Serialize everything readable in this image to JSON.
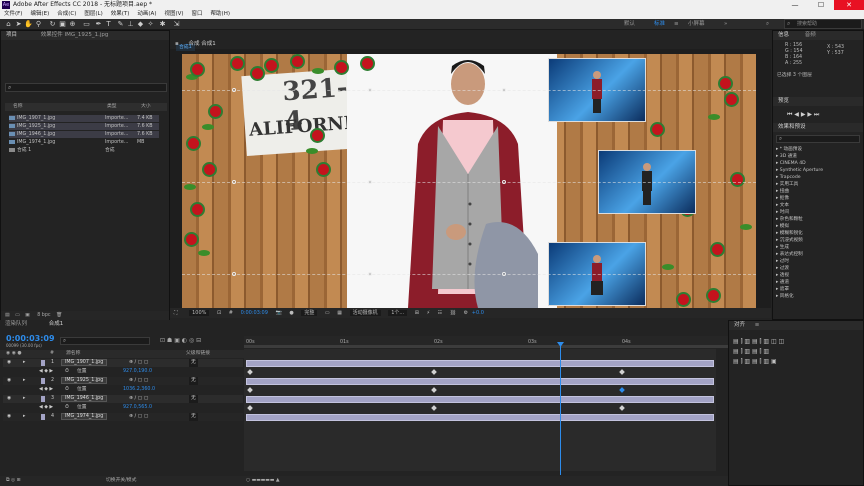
{
  "window": {
    "title": "Adobe After Effects CC 2018 - 无标题项目.aep *",
    "app_icon": "Ae",
    "min": "—",
    "max": "☐",
    "close": "✕"
  },
  "menu": [
    "文件(F)",
    "编辑(E)",
    "合成(C)",
    "图层(L)",
    "效果(T)",
    "动画(A)",
    "视图(V)",
    "窗口",
    "帮助(H)"
  ],
  "workspaces": {
    "default": "默认",
    "standard": "标准",
    "small_screen": "小屏幕",
    "more": "»",
    "menu": "≡"
  },
  "search": {
    "placeholder": "搜索帮助"
  },
  "project_panel": {
    "tabs": {
      "project": "项目",
      "effect_controls": "效果控件 IMG_1925_1.jpg"
    },
    "search_icon": "⌕",
    "columns": {
      "name": "名称",
      "type": "类型",
      "size": "大小"
    },
    "items": [
      {
        "name": "IMG_1907_1.jpg",
        "type": "Importe...",
        "size": "7.4 KB"
      },
      {
        "name": "IMG_1925_1.jpg",
        "type": "Importe...",
        "size": "7.6 KB"
      },
      {
        "name": "IMG_1946_1.jpg",
        "type": "Importe...",
        "size": "7.6 KB"
      },
      {
        "name": "IMG_1974_1.jpg",
        "type": "Importe...",
        "size": "MB"
      },
      {
        "name": "合成 1",
        "type": "合成",
        "size": ""
      }
    ],
    "bpc": "8 bpc"
  },
  "composition": {
    "tab": "合成 合成1",
    "breadcrumb": "合成1",
    "sign_line1": "321-4",
    "sign_line2": "ALIFORNIA",
    "footer": {
      "zoom": "100%",
      "time": "0:00:03:09",
      "quality": "完整",
      "camera": "活动摄像机",
      "views": "1个...",
      "exposure": "+0.0"
    }
  },
  "info_panel": {
    "tabs": {
      "info": "信息",
      "audio": "音频"
    },
    "r": "R : 156",
    "g": "G : 154",
    "b": "B : 164",
    "a": "A : 255",
    "x": "X : 543",
    "y": "Y : 537",
    "selected": "已选择 3 个图层"
  },
  "preview": {
    "tab": "预览",
    "controls": "⏮ ◀ ▶ ▶ ⏭"
  },
  "effects": {
    "tab": "效果和预设",
    "search_icon": "⌕",
    "items": [
      "* 动画预设",
      "3D 通道",
      "CINEMA 4D",
      "Synthetic Aperture",
      "Trapcode",
      "实用工具",
      "扭曲",
      "抠像",
      "文本",
      "时间",
      "杂色和颗粒",
      "模拟",
      "模糊和锐化",
      "沉浸式视频",
      "生成",
      "表达式控制",
      "过时",
      "过渡",
      "透视",
      "通道",
      "遮罩",
      "风格化"
    ]
  },
  "timeline": {
    "tabs": {
      "render": "渲染队列",
      "comp": "合成1"
    },
    "timecode": "0:00:03:09",
    "timecode_sub": "00099 (30.00 fps)",
    "search_icon": "⌕",
    "columns": {
      "label": "#",
      "name": "源名称",
      "parent": "父级和链接"
    },
    "ruler": [
      "00s",
      "01s",
      "02s",
      "03s",
      "04s"
    ],
    "layers": [
      {
        "num": "1",
        "name": "IMG_1907_1.jpg",
        "parent": "无",
        "prop": "位置",
        "value": "927.0,190.0"
      },
      {
        "num": "2",
        "name": "IMG_1925_1.jpg",
        "parent": "无",
        "prop": "位置",
        "value": "1036.2,360.0"
      },
      {
        "num": "3",
        "name": "IMG_1946_1.jpg",
        "parent": "无",
        "prop": "位置",
        "value": "927.0,565.0"
      },
      {
        "num": "4",
        "name": "IMG_1974_1.jpg",
        "parent": "无",
        "prop": "",
        "value": ""
      }
    ],
    "footer": "切换开关/模式"
  },
  "align_panel": {
    "tab": "对齐",
    "menu": "≡"
  }
}
